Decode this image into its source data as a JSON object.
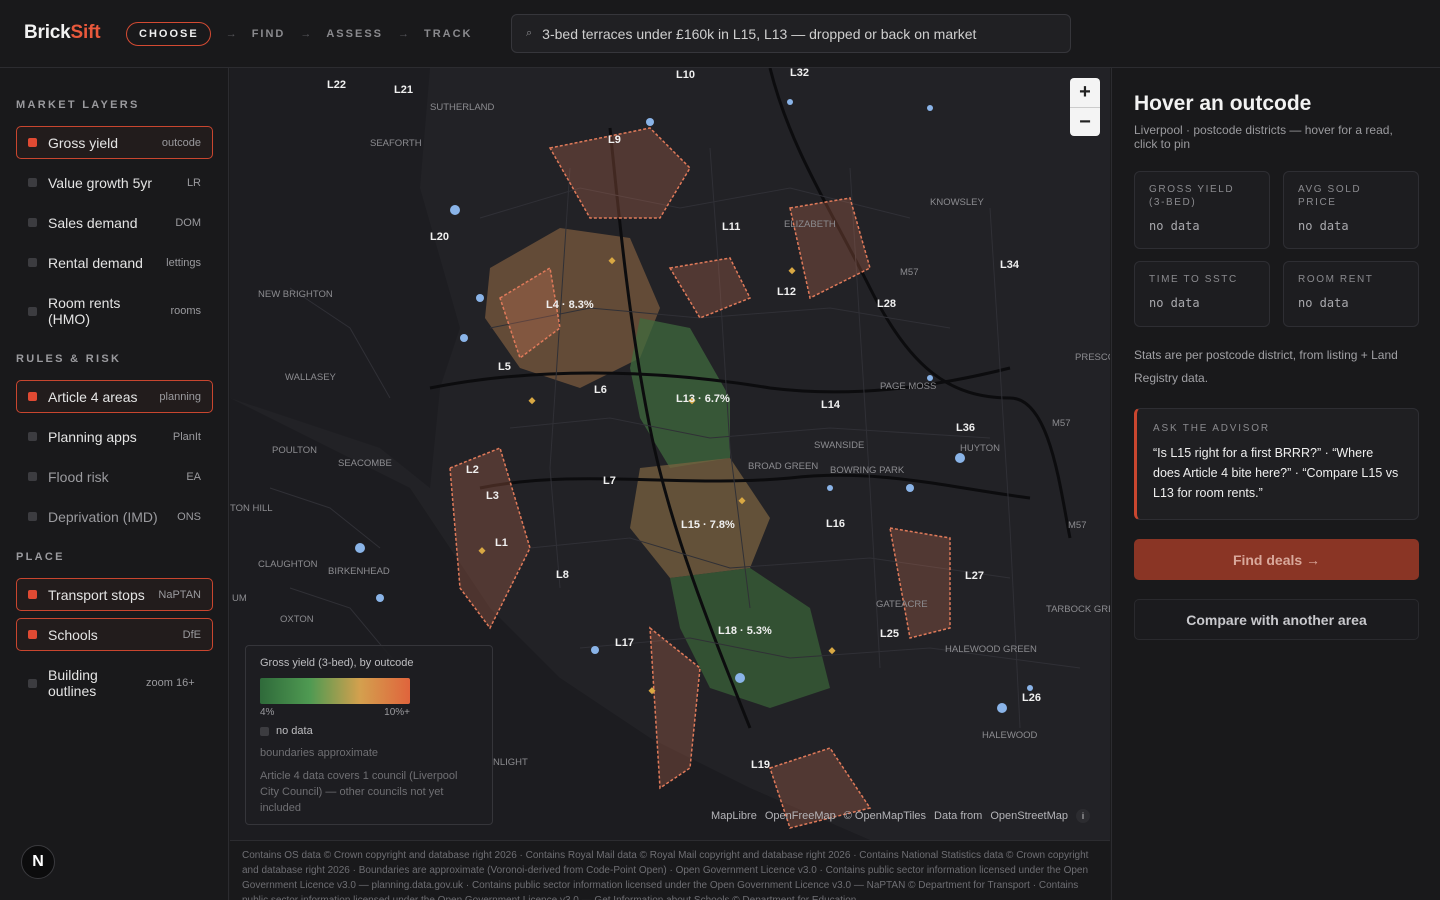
{
  "app": {
    "logo_main": "Brick",
    "logo_accent": "Sift",
    "steps": [
      {
        "label": "CHOOSE",
        "active": true
      },
      {
        "label": "FIND"
      },
      {
        "label": "ASSESS"
      },
      {
        "label": "TRACK"
      }
    ],
    "step_arrow": "→",
    "search": {
      "value": "3-bed terraces under £160k in L15, L13 — dropped or back on market",
      "icon": "search-icon"
    }
  },
  "sidebar": {
    "sections": [
      {
        "title": "MARKET LAYERS",
        "items": [
          {
            "label": "Gross yield",
            "source": "outcode",
            "on": true
          },
          {
            "label": "Value growth 5yr",
            "source": "LR"
          },
          {
            "label": "Sales demand",
            "source": "DOM"
          },
          {
            "label": "Rental demand",
            "source": "lettings"
          },
          {
            "label": "Room rents (HMO)",
            "source": "rooms"
          }
        ]
      },
      {
        "title": "RULES & RISK",
        "items": [
          {
            "label": "Article 4 areas",
            "source": "planning",
            "on": true
          },
          {
            "label": "Planning apps",
            "source": "PlanIt"
          },
          {
            "label": "Flood risk",
            "source": "EA",
            "dim": true
          },
          {
            "label": "Deprivation (IMD)",
            "source": "ONS",
            "dim": true
          }
        ]
      },
      {
        "title": "PLACE",
        "items": [
          {
            "label": "Transport stops",
            "source": "NaPTAN",
            "on": true
          },
          {
            "label": "Schools",
            "source": "DfE",
            "on": true
          },
          {
            "label": "Building outlines",
            "source": "zoom 16+"
          }
        ]
      }
    ]
  },
  "map": {
    "zoom_in": "+",
    "zoom_out": "−",
    "outcodes": [
      {
        "code": "L22"
      },
      {
        "code": "L21"
      },
      {
        "code": "L10"
      },
      {
        "code": "L32"
      },
      {
        "code": "L9"
      },
      {
        "code": "L20"
      },
      {
        "code": "L11"
      },
      {
        "code": "L34"
      },
      {
        "code": "L4",
        "yield": "8.3%"
      },
      {
        "code": "L12"
      },
      {
        "code": "L28"
      },
      {
        "code": "L5"
      },
      {
        "code": "L6"
      },
      {
        "code": "L13",
        "yield": "6.7%"
      },
      {
        "code": "L14"
      },
      {
        "code": "L36"
      },
      {
        "code": "L2"
      },
      {
        "code": "L7"
      },
      {
        "code": "L3"
      },
      {
        "code": "L15",
        "yield": "7.8%"
      },
      {
        "code": "L16"
      },
      {
        "code": "L1"
      },
      {
        "code": "L8"
      },
      {
        "code": "L27"
      },
      {
        "code": "L17"
      },
      {
        "code": "L18",
        "yield": "5.3%"
      },
      {
        "code": "L25"
      },
      {
        "code": "L26"
      },
      {
        "code": "L19"
      }
    ],
    "places": [
      "SUTHERLAND",
      "SEAFORTH",
      "NEW BRIGHTON",
      "WALLASEY",
      "POULTON",
      "SEACOMBE",
      "TON HILL",
      "CLAUGHTON",
      "BIRKENHEAD",
      "OXTON",
      "UM",
      "KNOWSLEY",
      "ELIZABETH",
      "M57",
      "PRESCO",
      "PAGE MOSS",
      "SWANSIDE",
      "BROAD GREEN",
      "BOWRING PARK",
      "HUYTON",
      "GATEACRE",
      "TARBOCK GRE",
      "HALEWOOD GREEN",
      "HALEWOOD",
      "NLIGHT",
      "M57",
      "M57"
    ],
    "legend": {
      "title": "Gross yield (3-bed), by outcode",
      "min": "4%",
      "max": "10%+",
      "no_data": "no data",
      "approx": "boundaries approximate",
      "article4": "Article 4 data covers 1 council (Liverpool City Council) — other councils not yet included"
    },
    "attribution": [
      "MapLibre",
      "OpenFreeMap",
      "© OpenMapTiles",
      "Data from",
      "OpenStreetMap"
    ],
    "info": "i"
  },
  "footer": "Contains OS data © Crown copyright and database right 2026 · Contains Royal Mail data © Royal Mail copyright and database right 2026 · Contains National Statistics data © Crown copyright and database right 2026 · Boundaries are approximate (Voronoi-derived from Code-Point Open) · Open Government Licence v3.0 · Contains public sector information licensed under the Open Government Licence v3.0 — planning.data.gov.uk · Contains public sector information licensed under the Open Government Licence v3.0 — NaPTAN © Department for Transport · Contains public sector information licensed under the Open Government Licence v3.0 — Get Information about Schools © Department for Education",
  "panel": {
    "title": "Hover an outcode",
    "subtitle": "Liverpool · postcode districts — hover for a read, click to pin",
    "stats": [
      {
        "key": "GROSS YIELD (3-BED)",
        "value": "no data"
      },
      {
        "key": "AVG SOLD PRICE",
        "value": "no data"
      },
      {
        "key": "TIME TO SSTC",
        "value": "no data"
      },
      {
        "key": "ROOM RENT",
        "value": "no data"
      }
    ],
    "note": "Stats are per postcode district, from listing + Land Registry data.",
    "advisor": {
      "title": "ASK THE ADVISOR",
      "text": "“Is L15 right for a first BRRR?” · “Where does Article 4 bite here?” · “Compare L15 vs L13 for room rents.”"
    },
    "find_button": "Find deals →",
    "compare_button": "Compare with another area"
  },
  "badge": "N",
  "colors": {
    "accent": "#e8593c",
    "yield_high": "#c87a4a",
    "yield_low": "#2f6a3a",
    "stop": "#8ab4e8",
    "school": "#d9a843",
    "article4": "#e07a5a"
  }
}
